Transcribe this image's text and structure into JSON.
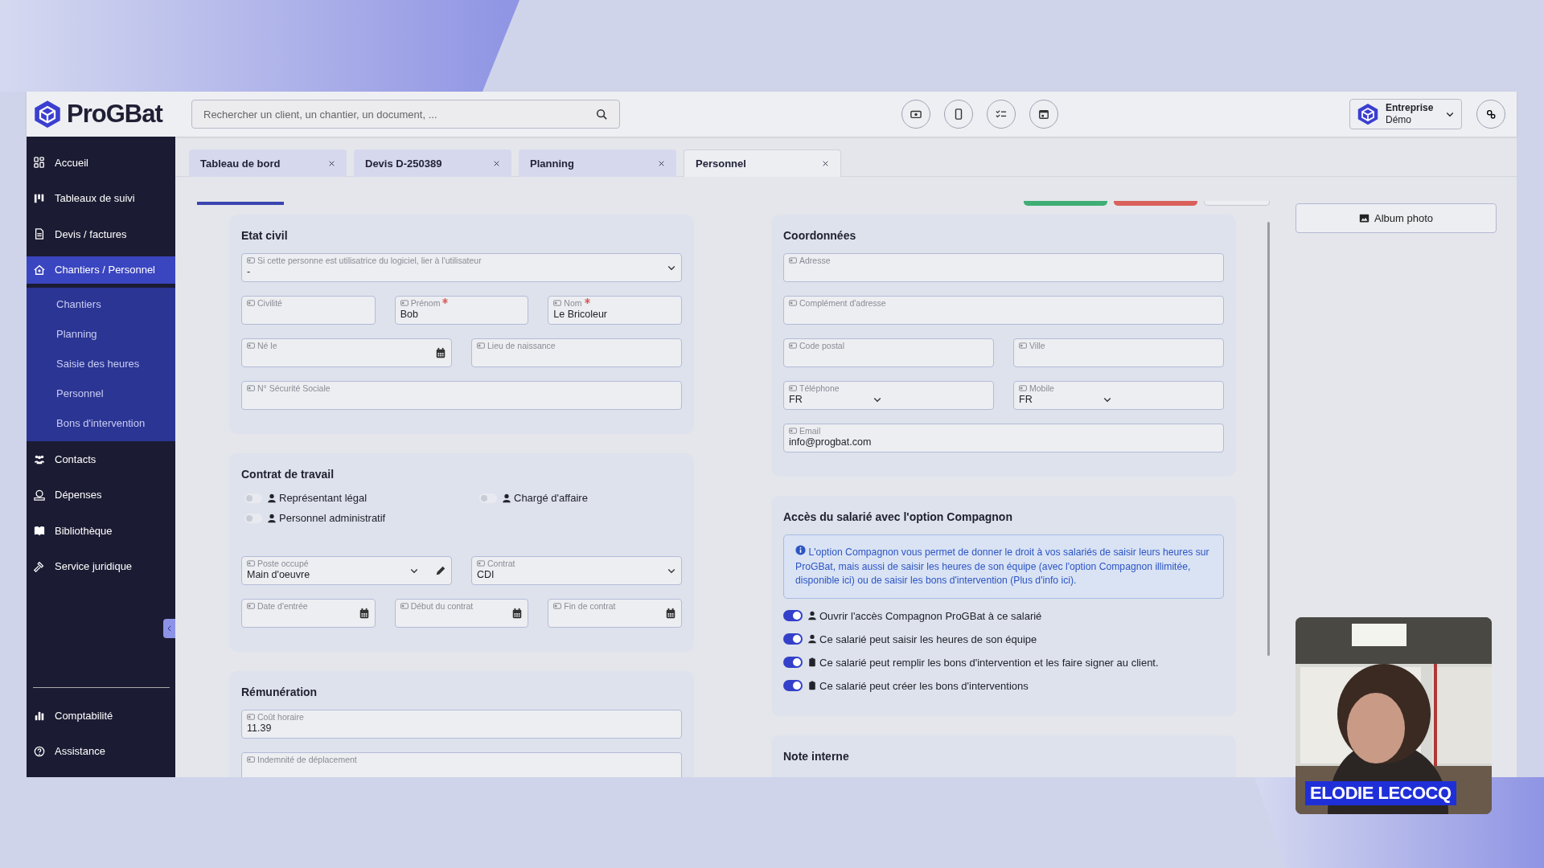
{
  "header": {
    "logo": "ProGBat",
    "search": {
      "placeholder": "Rechercher un client, un chantier, un document, ..."
    },
    "company": {
      "name": "Entreprise",
      "subtitle": "Démo"
    }
  },
  "sidebar": {
    "items": [
      {
        "label": "Accueil",
        "selected": false
      },
      {
        "label": "Tableaux de suivi",
        "selected": false
      },
      {
        "label": "Devis / factures",
        "selected": false
      },
      {
        "label": "Chantiers / Personnel",
        "selected": true,
        "expanded": true,
        "children": [
          {
            "label": "Chantiers",
            "selected": false
          },
          {
            "label": "Planning",
            "selected": false
          },
          {
            "label": "Saisie des heures",
            "selected": false
          },
          {
            "label": "Personnel",
            "selected": false
          },
          {
            "label": "Bons d'intervention",
            "selected": false
          }
        ]
      },
      {
        "label": "Contacts",
        "selected": false
      },
      {
        "label": "Dépenses",
        "selected": false
      },
      {
        "label": "Bibliothèque",
        "selected": false
      },
      {
        "label": "Service juridique",
        "selected": false
      }
    ],
    "bottom_items": [
      {
        "label": "Comptabilité",
        "selected": false
      },
      {
        "label": "Assistance",
        "selected": false
      }
    ]
  },
  "tabs": [
    {
      "label": "Tableau de bord",
      "selected": false
    },
    {
      "label": "Devis D-250389",
      "selected": false
    },
    {
      "label": "Planning",
      "selected": false
    },
    {
      "label": "Personnel",
      "selected": true
    }
  ],
  "album_button": {
    "label": "Album photo"
  },
  "left_sections": [
    {
      "title": "Etat civil",
      "blocks": [
        {
          "kind": "fields",
          "rows": [
            [
              {
                "kind": "select",
                "label": "Si cette personne est utilisatrice du logiciel, lier à l'utilisateur",
                "value": "-"
              }
            ],
            [
              {
                "kind": "text",
                "label": "Civilité"
              },
              {
                "kind": "text",
                "label": "Prénom",
                "required": true,
                "value": "Bob"
              },
              {
                "kind": "text",
                "label": "Nom",
                "required": true,
                "value": "Le Bricoleur"
              }
            ],
            [
              {
                "kind": "date",
                "label": "Né le"
              },
              {
                "kind": "text",
                "label": "Lieu de naissance"
              }
            ],
            [
              {
                "kind": "text",
                "label": "N° Sécurité Sociale"
              }
            ]
          ]
        }
      ]
    },
    {
      "title": "Contrat de travail",
      "blocks": [
        {
          "kind": "switch-grid",
          "items": [
            {
              "label": "Représentant légal",
              "on": false
            },
            {
              "label": "Chargé d'affaire",
              "on": false
            },
            {
              "label": "Personnel administratif",
              "on": false
            }
          ]
        },
        {
          "kind": "fields",
          "rows": [
            [
              {
                "kind": "select-edit",
                "label": "Poste occupé",
                "value": "Main d'oeuvre"
              },
              {
                "kind": "select",
                "label": "Contrat",
                "value": "CDI"
              }
            ],
            [
              {
                "kind": "date",
                "label": "Date d'entrée"
              },
              {
                "kind": "date",
                "label": "Début du contrat"
              },
              {
                "kind": "date",
                "label": "Fin de contrat"
              }
            ]
          ]
        }
      ]
    },
    {
      "title": "Rémunération",
      "blocks": [
        {
          "kind": "fields",
          "rows": [
            [
              {
                "kind": "text",
                "label": "Coût horaire",
                "value": "11.39"
              }
            ],
            [
              {
                "kind": "text",
                "label": "Indemnité de déplacement"
              }
            ]
          ]
        }
      ]
    }
  ],
  "right_sections": [
    {
      "title": "Coordonnées",
      "blocks": [
        {
          "kind": "fields",
          "rows": [
            [
              {
                "kind": "text",
                "label": "Adresse"
              }
            ],
            [
              {
                "kind": "text",
                "label": "Complément d'adresse"
              }
            ],
            [
              {
                "kind": "text",
                "label": "Code postal"
              },
              {
                "kind": "text",
                "label": "Ville"
              }
            ],
            [
              {
                "kind": "phone",
                "label": "Téléphone",
                "value": "FR"
              },
              {
                "kind": "phone",
                "label": "Mobile",
                "value": "FR"
              }
            ],
            [
              {
                "kind": "text",
                "label": "Email",
                "value": "info@progbat.com"
              }
            ]
          ]
        }
      ]
    },
    {
      "title": "Accès du salarié avec l'option Compagnon",
      "blocks": [
        {
          "kind": "notice",
          "text": "L'option Compagnon vous permet de donner le droit à vos salariés de saisir leurs heures sur ProGBat, mais aussi de saisir les heures de son équipe (avec l'option Compagnon illimitée, disponible ici) ou de saisir les bons d'intervention (Plus d'info ici)."
        },
        {
          "kind": "switch-list",
          "items": [
            {
              "label": "Ouvrir l'accès Compagnon ProGBat à ce salarié",
              "on": true
            },
            {
              "label": "Ce salarié peut saisir les heures de son équipe",
              "on": true
            },
            {
              "label": "Ce salarié peut remplir les bons d'intervention et les faire signer au client.",
              "on": true
            },
            {
              "label": "Ce salarié peut créer les bons d'interventions",
              "on": true
            }
          ]
        }
      ]
    },
    {
      "title": "Note interne"
    }
  ],
  "webcam": {
    "kind": "picture",
    "caption": "ELODIE LECOCQ"
  }
}
